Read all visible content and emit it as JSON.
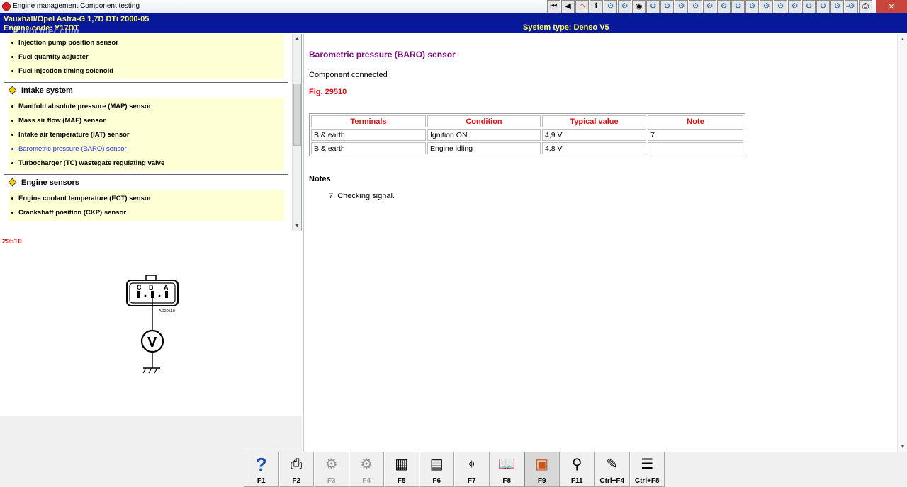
{
  "window": {
    "title": "Engine management Component testing"
  },
  "toolbar": {
    "icons": [
      "first-icon",
      "prev-icon",
      "warning-icon",
      "info-icon",
      "gear-icon",
      "gear-icon",
      "sensor-icon",
      "gear-icon",
      "gear-icon",
      "gear-icon",
      "gear-icon",
      "gear-icon",
      "gear-icon",
      "gear-icon",
      "gear-icon",
      "gear-icon",
      "gear-icon",
      "gear-icon",
      "gear-icon",
      "gear-icon",
      "gear-icon",
      "gear-icon",
      "print-icon"
    ],
    "controls": [
      "–",
      "□",
      "✕"
    ]
  },
  "header": {
    "vehicle": "Vauxhall/Opel   Astra-G  1,7D DTi 2000-05",
    "engine": "Engine code: Y17DT",
    "system": "System type: Denso V5",
    "watermark": "ClubOpel.com"
  },
  "tree": {
    "groups": [
      {
        "label": "",
        "items": [
          "Injection pump position sensor",
          "Fuel quantity adjuster",
          "Fuel injection timing solenoid"
        ]
      },
      {
        "label": "Intake system",
        "items": [
          "Manifold absolute pressure (MAP) sensor",
          "Mass air flow (MAF) sensor",
          "Intake air temperature (IAT) sensor",
          "Barometric pressure (BARO) sensor",
          "Turbocharger (TC) wastegate regulating valve"
        ]
      },
      {
        "label": "Engine sensors",
        "items": [
          "Engine coolant temperature (ECT) sensor",
          "Crankshaft position (CKP) sensor"
        ]
      }
    ],
    "active_item": "Barometric pressure (BARO) sensor"
  },
  "figure": {
    "number": "29510",
    "pin_labels": [
      "C",
      "B",
      "A"
    ],
    "code": "AD29510",
    "meter": "V"
  },
  "content": {
    "title": "Barometric pressure (BARO) sensor",
    "connected": "Component connected",
    "fig": "Fig. 29510",
    "table": {
      "headers": [
        "Terminals",
        "Condition",
        "Typical value",
        "Note"
      ],
      "rows": [
        [
          "B & earth",
          "Ignition ON",
          "4,9 V",
          "7"
        ],
        [
          "B & earth",
          "Engine idling",
          "4,8 V",
          ""
        ]
      ]
    },
    "notes_title": "Notes",
    "notes": [
      "7. Checking signal."
    ]
  },
  "fkeys": [
    {
      "label": "F1",
      "icon": "help-icon",
      "enabled": true
    },
    {
      "label": "F2",
      "icon": "print-icon",
      "enabled": true
    },
    {
      "label": "F3",
      "icon": "component-icon",
      "enabled": false
    },
    {
      "label": "F4",
      "icon": "component-icon",
      "enabled": false
    },
    {
      "label": "F5",
      "icon": "connector-icon",
      "enabled": true
    },
    {
      "label": "F6",
      "icon": "connector-pins-icon",
      "enabled": true
    },
    {
      "label": "F7",
      "icon": "test-probe-icon",
      "enabled": true
    },
    {
      "label": "F8",
      "icon": "book-icon",
      "enabled": true
    },
    {
      "label": "F9",
      "icon": "sensor-image-icon",
      "enabled": true,
      "pressed": true
    },
    {
      "label": "F11",
      "icon": "search-icon",
      "enabled": true
    },
    {
      "label": "Ctrl+F4",
      "icon": "notes-icon",
      "enabled": true
    },
    {
      "label": "Ctrl+F8",
      "icon": "list-icon",
      "enabled": true
    }
  ]
}
